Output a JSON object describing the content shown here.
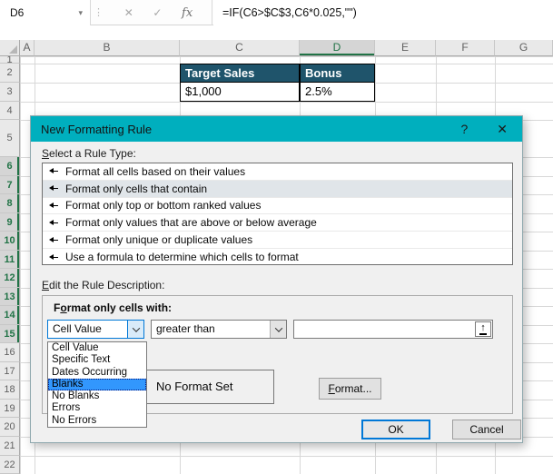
{
  "formula_bar": {
    "name_box": "D6",
    "formula": "=IF(C6>$C$3,C6*0.025,\"\")",
    "icons": {
      "divider": "⋮",
      "cancel": "✕",
      "enter": "✓",
      "insert_function": "fx",
      "name_box_caret": "▾"
    }
  },
  "grid": {
    "column_headers": [
      "A",
      "B",
      "C",
      "D",
      "E",
      "F",
      "G"
    ],
    "row_headers": [
      1,
      2,
      3,
      4,
      5,
      6,
      7,
      8,
      9,
      10,
      11,
      12,
      13,
      14,
      15,
      16,
      17,
      18,
      19,
      20,
      21,
      22
    ],
    "selected_column": "D",
    "selected_rows": {
      "from": 6,
      "to": 15
    },
    "cells": [
      {
        "ref": "C2",
        "text": "Target Sales",
        "style": "header"
      },
      {
        "ref": "D2",
        "text": "Bonus",
        "style": "header"
      },
      {
        "ref": "C3",
        "text": "$1,000",
        "style": "value"
      },
      {
        "ref": "D3",
        "text": "2.5%",
        "style": "value"
      }
    ]
  },
  "dialog": {
    "title": "New Formatting Rule",
    "help_icon": "?",
    "close_icon": "✕",
    "rule_type_label": {
      "accel": "S",
      "rest": "elect a Rule Type:"
    },
    "rule_types": [
      "Format all cells based on their values",
      "Format only cells that contain",
      "Format only top or bottom ranked values",
      "Format only values that are above or below average",
      "Format only unique or duplicate values",
      "Use a formula to determine which cells to format"
    ],
    "selected_rule_type": "Format only cells that contain",
    "edit_description_label": {
      "accel": "E",
      "rest": "dit the Rule Description:"
    },
    "format_only_label": {
      "pre": "F",
      "accel": "o",
      "rest": "rmat only cells with:"
    },
    "cell_value_combo": {
      "value": "Cell Value",
      "options": [
        "Cell Value",
        "Specific Text",
        "Dates Occurring",
        "Blanks",
        "No Blanks",
        "Errors",
        "No Errors"
      ],
      "highlighted_option": "Blanks"
    },
    "condition_combo": {
      "value": "greater than"
    },
    "value_field": {
      "value": ""
    },
    "preview_text": "No Format Set",
    "format_button": {
      "accel": "F",
      "rest": "ormat..."
    },
    "ok_button": "OK",
    "cancel_button": "Cancel"
  },
  "colors": {
    "title_teal": "#00AFBE",
    "excel_green": "#217346",
    "header_fill": "#1F546B",
    "focus_blue": "#0078D7",
    "dropdown_highlight": "#3297FD"
  }
}
